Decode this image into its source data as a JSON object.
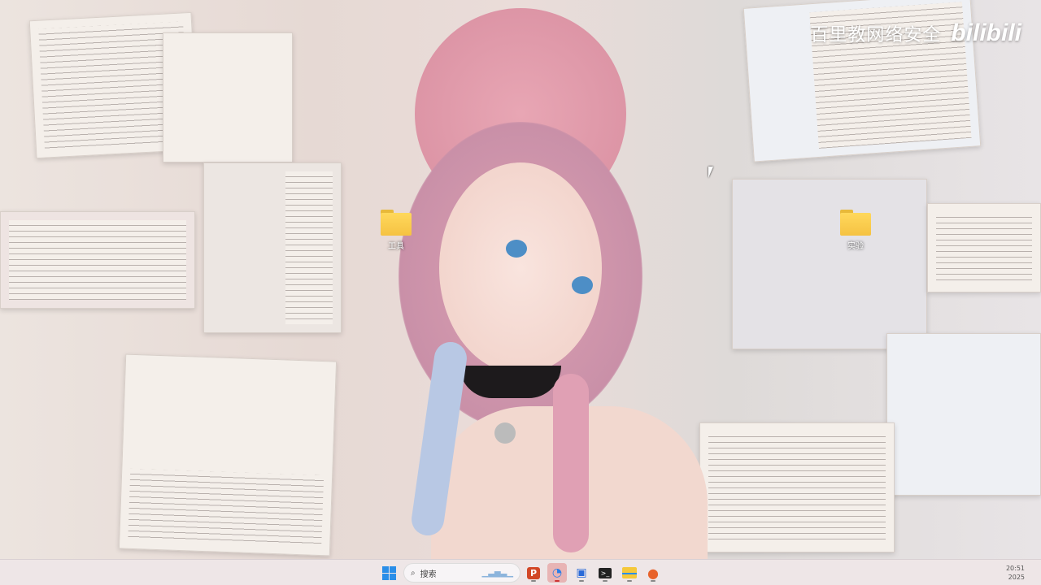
{
  "watermark": {
    "text": "百里教网络安全",
    "logo": "bilibili"
  },
  "desktop": {
    "icons": [
      {
        "label": "工具",
        "icon": "folder-icon"
      },
      {
        "label": "实验",
        "icon": "folder-icon"
      }
    ]
  },
  "taskbar": {
    "search_placeholder": "搜索",
    "apps": [
      {
        "name": "powerpoint",
        "glyph": "P",
        "color": "#d24726"
      },
      {
        "name": "chat",
        "glyph": "◔",
        "color": "#2a7ee8"
      },
      {
        "name": "remote-app",
        "glyph": "▣",
        "color": "#2a6ad8"
      },
      {
        "name": "terminal",
        "glyph": ">_",
        "color": "#222"
      },
      {
        "name": "file-explorer",
        "glyph": "▬",
        "color": "#f0c030"
      },
      {
        "name": "firefox",
        "glyph": "●",
        "color": "#e8622a"
      }
    ],
    "time": "20:51",
    "date": "2025"
  }
}
